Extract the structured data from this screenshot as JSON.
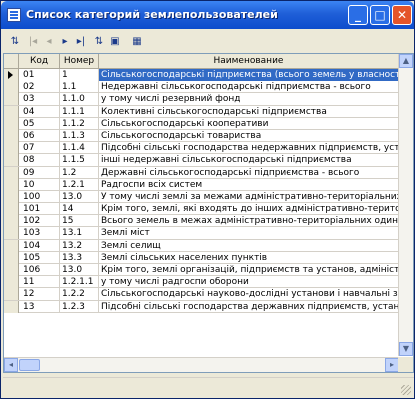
{
  "window": {
    "title": "Список категорий землепользователей",
    "buttons": {
      "minimize": "_",
      "maximize": "□",
      "close": "✕"
    }
  },
  "toolbar": {
    "items": [
      {
        "name": "sort-icon",
        "glyph": "⇅"
      },
      {
        "name": "first-record-icon",
        "glyph": "|◂",
        "disabled": true
      },
      {
        "name": "prev-record-icon",
        "glyph": "◂",
        "disabled": true
      },
      {
        "name": "next-record-icon",
        "glyph": "▸"
      },
      {
        "name": "last-record-icon",
        "glyph": "▸|"
      },
      {
        "name": "filter-icon",
        "glyph": "⇅"
      },
      {
        "name": "export-icon",
        "glyph": "▣"
      },
      {
        "name": "print-icon",
        "glyph": "▦"
      }
    ]
  },
  "grid": {
    "columns": [
      "Код",
      "Номер",
      "Наименование"
    ],
    "rows": [
      {
        "kod": "01",
        "nomer": "1",
        "name": "Сільськогосподарські підприємства (всього земель у власності і користува",
        "selected": true
      },
      {
        "kod": "02",
        "nomer": "1.1",
        "name": "Недержавні сільськогосподарські підприємства - всього"
      },
      {
        "kod": "03",
        "nomer": "1.1.0",
        "name": "у тому числі резервний фонд"
      },
      {
        "kod": "04",
        "nomer": "1.1.1",
        "name": "Колективні сільськогосподарські підприємства"
      },
      {
        "kod": "05",
        "nomer": "1.1.2",
        "name": "Сільськогосподарські кооперативи"
      },
      {
        "kod": "06",
        "nomer": "1.1.3",
        "name": "Сільськогосподарські товариства"
      },
      {
        "kod": "07",
        "nomer": "1.1.4",
        "name": "Підсобні сільські господарства недержавних підприємств, установ та орга"
      },
      {
        "kod": "08",
        "nomer": "1.1.5",
        "name": "інші недержавні сільськогосподарські підприємства"
      },
      {
        "kod": "09",
        "nomer": "1.2",
        "name": "Державні сільськогосподарські підприємства - всього"
      },
      {
        "kod": "10",
        "nomer": "1.2.1",
        "name": "Радгоспи всіх систем"
      },
      {
        "kod": "100",
        "nomer": "13.0",
        "name": "У тому числі землі за межами адміністративно-територіальних одиниць"
      },
      {
        "kod": "101",
        "nomer": "14",
        "name": "Крім того, землі, які входять до інших адміністративно-територіальних один"
      },
      {
        "kod": "102",
        "nomer": "15",
        "name": "Всього земель в межах адміністративно-територіальних одиниць"
      },
      {
        "kod": "103",
        "nomer": "13.1",
        "name": "Землі міст"
      },
      {
        "kod": "104",
        "nomer": "13.2",
        "name": "Землі селищ"
      },
      {
        "kod": "105",
        "nomer": "13.3",
        "name": "Землі сільських населених пунктів"
      },
      {
        "kod": "106",
        "nomer": "13.0",
        "name": "Крім того, землі організацій, підприємств та установ, адміністративно під"
      },
      {
        "kod": "11",
        "nomer": "1.2.1.1",
        "name": "у тому числі радгоспи оборони"
      },
      {
        "kod": "12",
        "nomer": "1.2.2",
        "name": "Сільськогосподарські науково-дослідні установи і навчальні заклади"
      },
      {
        "kod": "13",
        "nomer": "1.2.3",
        "name": "Підсобні сільські господарства державних підприємств, установ, організац"
      }
    ]
  },
  "scroll": {
    "up": "▲",
    "down": "▼",
    "left": "◂",
    "right": "▸"
  }
}
